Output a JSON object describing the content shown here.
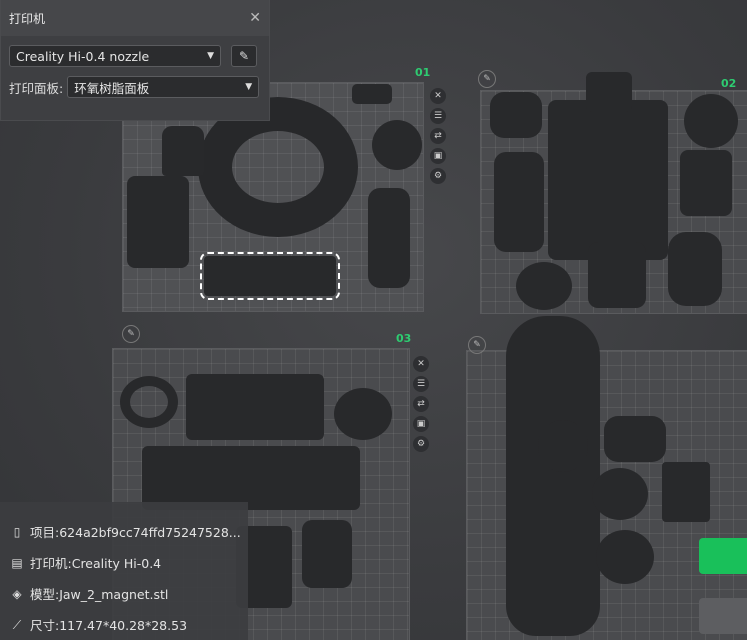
{
  "printer_panel": {
    "title": "打印机",
    "close_icon": "close-icon",
    "nozzle_select": "Creality Hi-0.4 nozzle",
    "plate_label": "打印面板:",
    "plate_select": "环氧树脂面板"
  },
  "plates": [
    {
      "number": "01"
    },
    {
      "number": "02"
    },
    {
      "number": "03"
    },
    {
      "number": ""
    }
  ],
  "info": {
    "project_label": "项目:624a2bf9cc74ffd75247528...",
    "printer_label": "打印机:Creality Hi-0.4",
    "model_label": "模型:Jaw_2_magnet.stl",
    "size_label": "尺寸:117.47*40.28*28.53"
  },
  "colors": {
    "accent": "#19c05a",
    "plate_number": "#2ecc71"
  }
}
